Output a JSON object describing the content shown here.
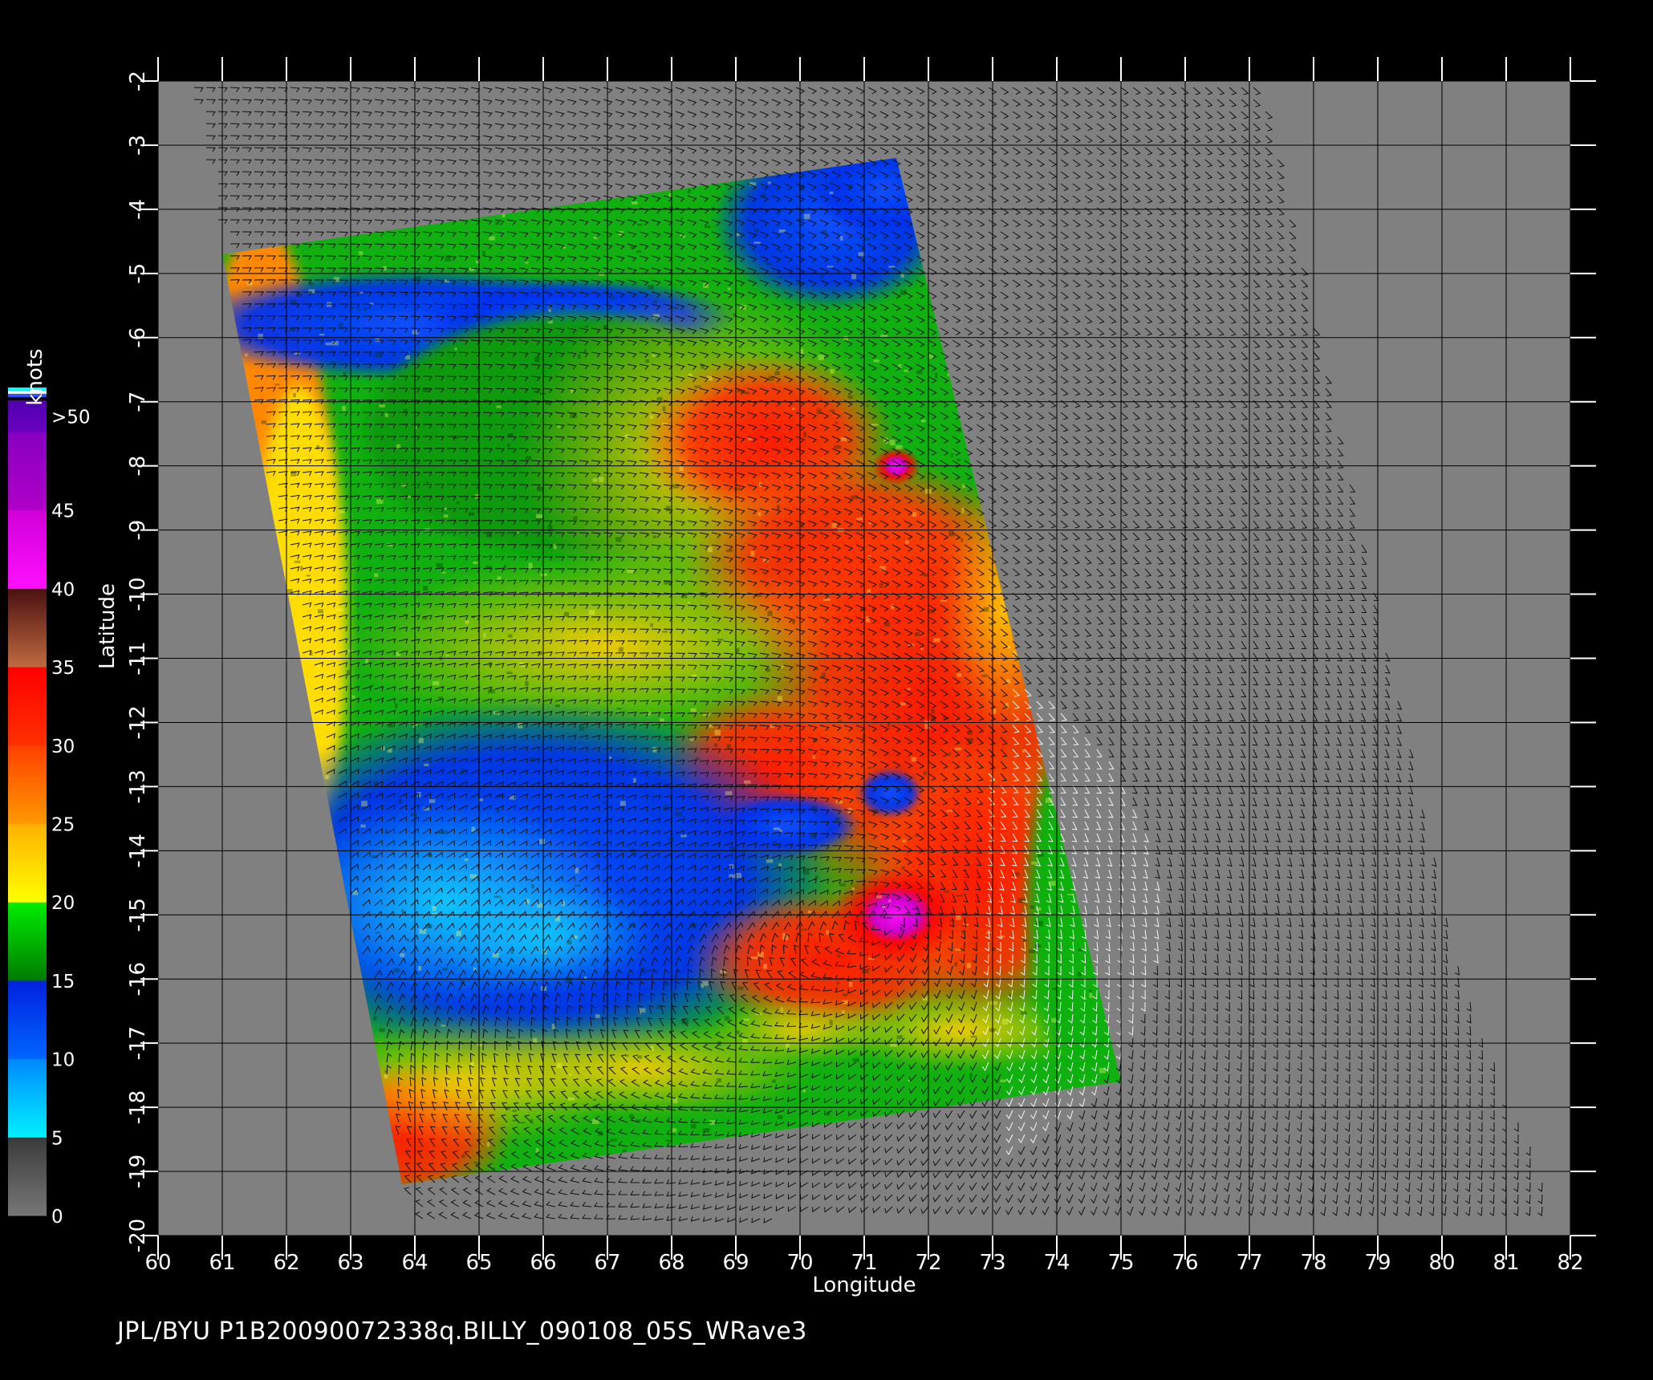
{
  "colorbar": {
    "unit": "knots",
    "labels": [
      ">50",
      "45",
      "40",
      "35",
      "30",
      "25",
      "20",
      "15",
      "10",
      "5",
      "0"
    ],
    "bands": [
      {
        "from": 0,
        "to": 5,
        "colors": [
          "#777777",
          "#3a3a3a"
        ]
      },
      {
        "from": 5,
        "to": 10,
        "colors": [
          "#00f0ff",
          "#0088ff"
        ]
      },
      {
        "from": 10,
        "to": 15,
        "colors": [
          "#0066ff",
          "#0020e0"
        ]
      },
      {
        "from": 15,
        "to": 20,
        "colors": [
          "#007a00",
          "#00ee00"
        ]
      },
      {
        "from": 20,
        "to": 25,
        "colors": [
          "#ffff00",
          "#ffb000"
        ]
      },
      {
        "from": 25,
        "to": 30,
        "colors": [
          "#ff9800",
          "#ff4000"
        ]
      },
      {
        "from": 30,
        "to": 35,
        "colors": [
          "#ff3000",
          "#ff0000"
        ]
      },
      {
        "from": 35,
        "to": 40,
        "colors": [
          "#c06a40",
          "#4a1010"
        ]
      },
      {
        "from": 40,
        "to": 45,
        "colors": [
          "#ff10ff",
          "#d000d8"
        ]
      },
      {
        "from": 45,
        "to": 50,
        "colors": [
          "#b000c8",
          "#8800c0"
        ]
      },
      {
        "from": 50,
        "to": 52,
        "colors": [
          "#6a00c0",
          "#5000b0"
        ]
      }
    ],
    "top_stripes": [
      "#00ffff",
      "#ffffff",
      "#3050ff"
    ]
  },
  "axes": {
    "xlabel": "Longitude",
    "ylabel": "Latitude",
    "lon_range": [
      60,
      82
    ],
    "lat_range": [
      -20,
      -2
    ],
    "lon_ticks": [
      "60",
      "61",
      "62",
      "63",
      "64",
      "65",
      "66",
      "67",
      "68",
      "69",
      "70",
      "71",
      "72",
      "73",
      "74",
      "75",
      "76",
      "77",
      "78",
      "79",
      "80",
      "81",
      "82"
    ],
    "lat_ticks": [
      "-2",
      "-3",
      "-4",
      "-5",
      "-6",
      "-7",
      "-8",
      "-9",
      "-10",
      "-11",
      "-12",
      "-13",
      "-14",
      "-15",
      "-16",
      "-17",
      "-18",
      "-19",
      "-20"
    ]
  },
  "swath": {
    "corners_lonlat": [
      [
        61.0,
        -4.7
      ],
      [
        71.5,
        -3.2
      ],
      [
        75.0,
        -17.6
      ],
      [
        63.8,
        -19.2
      ]
    ]
  },
  "storm": {
    "center_lonlat": [
      71.5,
      -15.0
    ]
  },
  "background_color": "#808080",
  "footer": "JPL/BYU  P1B20090072338q.BILLY_090108_05S_WRave3"
}
